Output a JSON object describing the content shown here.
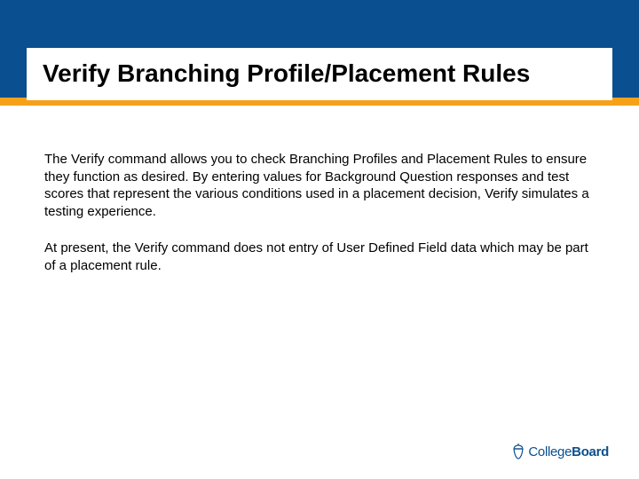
{
  "colors": {
    "header_bg": "#0a4f8f",
    "accent_bar": "#f5a11a",
    "title_bg": "#ffffff",
    "text": "#000000",
    "logo": "#0a4f8f"
  },
  "title": "Verify Branching Profile/Placement Rules",
  "body": {
    "p1": "The Verify command allows you to check Branching Profiles and Placement Rules to ensure they function as desired. By entering values for Background Question responses and test scores that represent the various conditions used in a placement decision, Verify simulates a testing experience.",
    "p2": "At present, the Verify command does not entry of User Defined Field data which may be part of a placement rule."
  },
  "footer": {
    "logo_icon": "acorn-icon",
    "logo_text_light": "College",
    "logo_text_bold": "Board"
  }
}
